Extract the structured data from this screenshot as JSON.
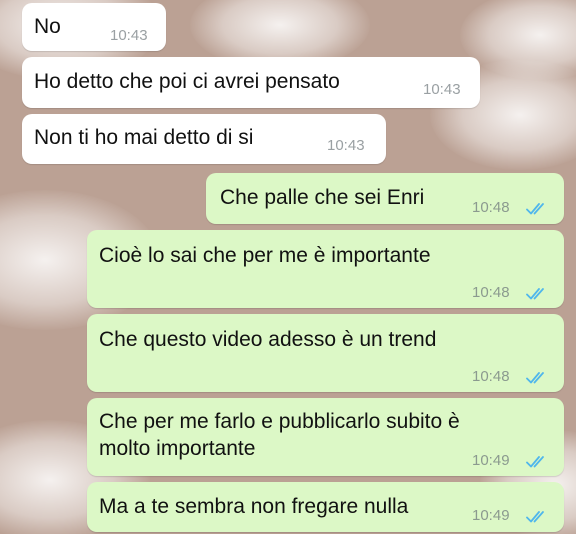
{
  "colors": {
    "wallpaper": "#bba194",
    "incoming_bubble": "#ffffff",
    "outgoing_bubble": "#dcf8c6",
    "read_ticks": "#4fb6ec"
  },
  "messages": [
    {
      "direction": "incoming",
      "text": "No",
      "time": "10:43"
    },
    {
      "direction": "incoming",
      "text": "Ho detto che poi ci avrei pensato",
      "time": "10:43"
    },
    {
      "direction": "incoming",
      "text": "Non ti ho mai detto di si",
      "time": "10:43"
    },
    {
      "direction": "outgoing",
      "text": "Che palle che sei Enri",
      "time": "10:48",
      "status_icon": "double-check-read-icon"
    },
    {
      "direction": "outgoing",
      "text": "Cioè lo sai che per me è importante",
      "time": "10:48",
      "status_icon": "double-check-read-icon"
    },
    {
      "direction": "outgoing",
      "text": "Che questo video adesso è un trend",
      "time": "10:48",
      "status_icon": "double-check-read-icon"
    },
    {
      "direction": "outgoing",
      "text": "Che per me farlo e pubblicarlo subito è molto importante",
      "time": "10:49",
      "status_icon": "double-check-read-icon"
    },
    {
      "direction": "outgoing",
      "text": "Ma a te sembra non fregare nulla",
      "time": "10:49",
      "status_icon": "double-check-read-icon"
    }
  ]
}
